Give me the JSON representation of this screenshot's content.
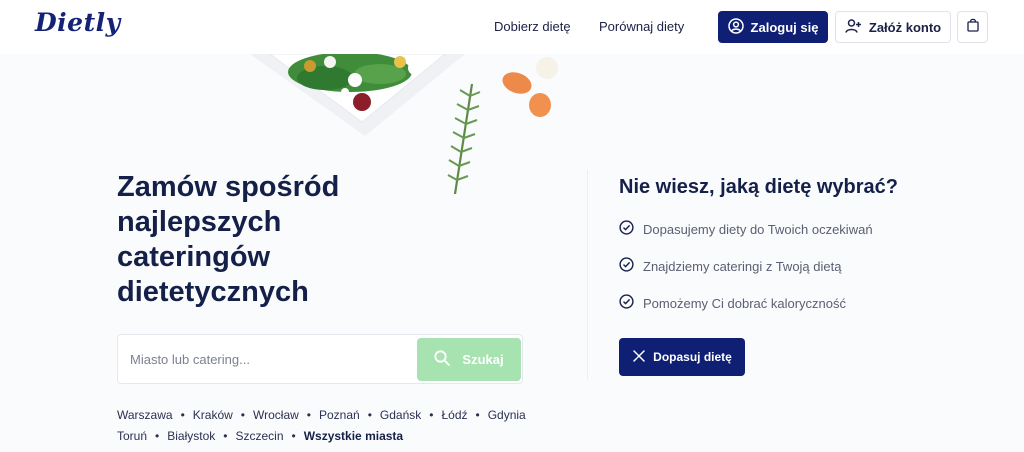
{
  "header": {
    "logo": "Dietly",
    "nav": [
      "Dobierz dietę",
      "Porównaj diety"
    ],
    "login_label": "Zaloguj się",
    "register_label": "Załóż konto",
    "icons": {
      "login": "user-circle-icon",
      "register": "user-plus-icon",
      "cart": "shopping-bag-icon"
    }
  },
  "hero": {
    "title": "Zamów spośród najlepszych cateringów dietetycznych",
    "search_placeholder": "Miasto lub catering...",
    "search_value": "",
    "search_button": "Szukaj",
    "cities_row1": [
      "Warszawa",
      "Kraków",
      "Wrocław",
      "Poznań",
      "Gdańsk",
      "Łódź",
      "Gdynia"
    ],
    "cities_row2": [
      "Toruń",
      "Białystok",
      "Szczecin"
    ],
    "all_cities": "Wszystkie miasta"
  },
  "right": {
    "title": "Nie wiesz, jaką dietę wybrać?",
    "benefits": [
      "Dopasujemy diety do Twoich oczekiwań",
      "Znajdziemy cateringi z Twoją dietą",
      "Pomożemy Ci dobrać kaloryczność"
    ],
    "cta": "Dopasuj dietę"
  },
  "colors": {
    "primary": "#0f1f73",
    "search_button": "#a7e3b1",
    "text": "#152049"
  }
}
